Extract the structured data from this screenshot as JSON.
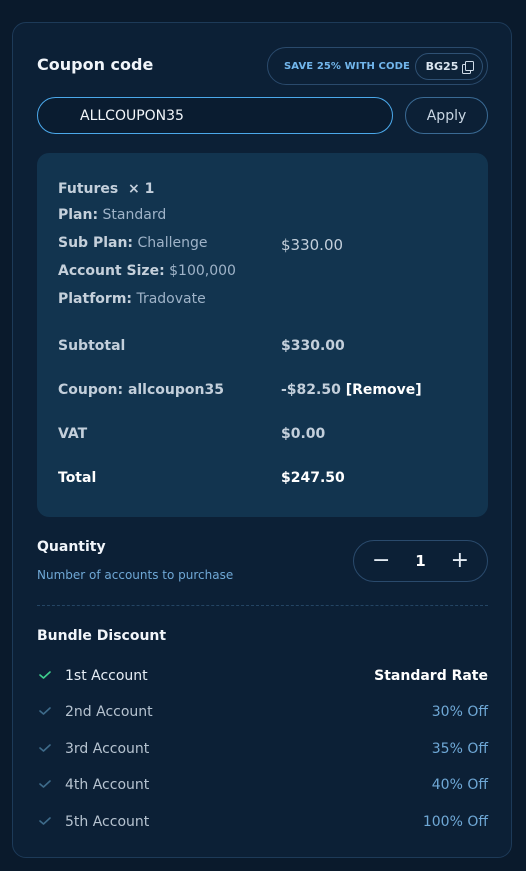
{
  "coupon": {
    "title": "Coupon code",
    "promo_text": "SAVE 25% WITH CODE",
    "promo_code": "BG25",
    "input_value": "ALLCOUPON35",
    "apply_label": "Apply"
  },
  "summary": {
    "product": "Futures",
    "product_qty": "× 1",
    "plan_label": "Plan:",
    "plan_value": "Standard",
    "subplan_label": "Sub Plan:",
    "subplan_value": "Challenge",
    "account_size_label": "Account Size:",
    "account_size_value": "$100,000",
    "platform_label": "Platform:",
    "platform_value": "Tradovate",
    "line_price": "$330.00",
    "subtotal_label": "Subtotal",
    "subtotal_value": "$330.00",
    "coupon_label": "Coupon: allcoupon35",
    "coupon_value": "-$82.50",
    "remove_label": "[Remove]",
    "vat_label": "VAT",
    "vat_value": "$0.00",
    "total_label": "Total",
    "total_value": "$247.50"
  },
  "quantity": {
    "title": "Quantity",
    "subtitle": "Number of accounts to purchase",
    "minus": "−",
    "value": "1",
    "plus": "+"
  },
  "bundle": {
    "title": "Bundle Discount",
    "rows": [
      {
        "label": "1st Account",
        "value": "Standard Rate"
      },
      {
        "label": "2nd Account",
        "value": "30% Off"
      },
      {
        "label": "3rd Account",
        "value": "35% Off"
      },
      {
        "label": "4th Account",
        "value": "40% Off"
      },
      {
        "label": "5th Account",
        "value": "100% Off"
      }
    ]
  },
  "colors": {
    "accent": "#4ba8ea",
    "check_active": "#3ecf8e",
    "check_inactive": "#3e6b8a"
  }
}
